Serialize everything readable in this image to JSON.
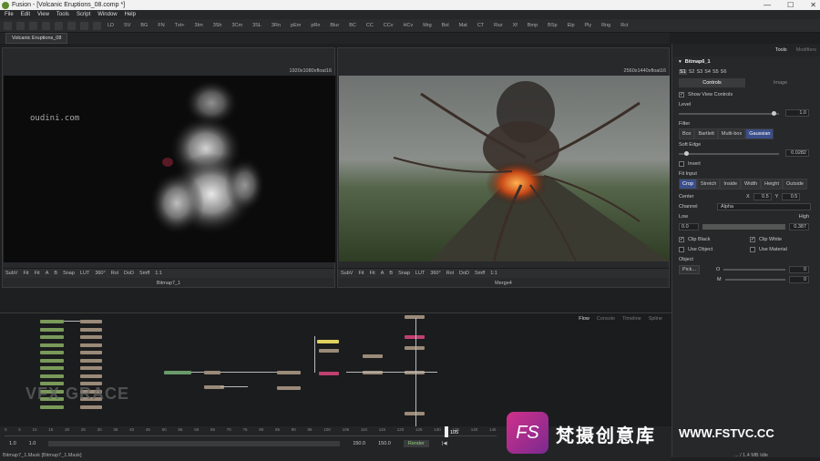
{
  "window": {
    "title": "Fusion - [Volcanic Eruptions_08.comp *]",
    "min": "—",
    "max": "☐",
    "close": "✕"
  },
  "menu": [
    "File",
    "Edit",
    "View",
    "Tools",
    "Script",
    "Window",
    "Help"
  ],
  "toolbar": [
    "LD",
    "SV",
    "BG",
    "FN",
    "Txt+",
    "3Im",
    "3Sh",
    "3Cm",
    "3SL",
    "3Rn",
    "pEm",
    "pRn",
    "Blur",
    "BC",
    "CC",
    "CCv",
    "HCv",
    "Mrg",
    "Bol",
    "Mat",
    "CT",
    "Rsz",
    "Xf",
    "Bmp",
    "BSp",
    "Elp",
    "Ply",
    "Rng",
    "Rct"
  ],
  "comp_tab": "Volcanic Eruptions_08",
  "viewer_left": {
    "res": "1920x1080xfloat16",
    "name": "Bitmap7_1",
    "watermark": "oudini.com"
  },
  "viewer_right": {
    "res": "2560x1440xfloat16",
    "name": "Merge4"
  },
  "viewer_bar": [
    "SubV",
    "Fit",
    "Fit",
    "A",
    "B",
    "Snap",
    "LUT",
    "360°",
    "Rol",
    "DoD",
    "Smff",
    "1:1"
  ],
  "panel": {
    "tab_tools": "Tools",
    "tab_modifiers": "Modifiers",
    "node_name": "Bitmap6_1",
    "slots": [
      "S1",
      "S2",
      "S3",
      "S4",
      "S5",
      "S6"
    ],
    "sub_tabs": [
      "Controls",
      "Image"
    ],
    "show_view_controls": "Show View Controls",
    "level_label": "Level",
    "level_value": "1.0",
    "level_frac": 0.97,
    "filter_label": "Filter",
    "filters": [
      "Box",
      "Bartlett",
      "Multi-box",
      "Gaussian"
    ],
    "soft_edge_label": "Soft Edge",
    "soft_edge_value": "0.0282",
    "soft_edge_frac": 0.06,
    "invert": "Invert",
    "fit_input_label": "Fit Input",
    "fit_options": [
      "Crop",
      "Stretch",
      "Inside",
      "Width",
      "Height",
      "Outside"
    ],
    "center_label": "Center",
    "center_x_label": "X",
    "center_x": "0.5",
    "center_y_label": "Y",
    "center_y": "0.5",
    "channel_label": "Channel",
    "channel_value": "Alpha",
    "low_label": "Low",
    "high_label": "High",
    "low_value": "0.0",
    "high_value": "0.387",
    "clip_black": "Clip Black",
    "clip_white": "Clip White",
    "use_object": "Use Object",
    "use_material": "Use Material",
    "object_label": "Object",
    "pick_label": "Pick...",
    "o_label": "O",
    "m_label": "M",
    "o_value": "0",
    "m_value": "0"
  },
  "flow_tabs": [
    "Flow",
    "Console",
    "Timeline",
    "Spline"
  ],
  "timeline": {
    "start": "1.0",
    "start2": "1.0",
    "end": "150.0",
    "end2": "150.0",
    "current": "105",
    "render": "Render",
    "ticks": [
      "0",
      "5",
      "10",
      "15",
      "20",
      "25",
      "30",
      "35",
      "40",
      "45",
      "50",
      "55",
      "60",
      "65",
      "70",
      "75",
      "80",
      "85",
      "90",
      "95",
      "100",
      "105",
      "110",
      "115",
      "120",
      "125",
      "130",
      "135",
      "140",
      "145"
    ]
  },
  "status": {
    "left": "Bitmap7_1.Mask  [Bitmap7_1.Mask]",
    "right": "... / 1.4 MB   Idle"
  },
  "watermarks": {
    "brand_left": "VFX GRACE",
    "brand_right_cn": "梵摄创意库",
    "brand_right_url": "WWW.FSTVC.CC",
    "fs": "FS"
  },
  "colors": {
    "accent": "#3a4e8a",
    "selected_node": "#c04070",
    "yellow_node": "#e0d060"
  }
}
